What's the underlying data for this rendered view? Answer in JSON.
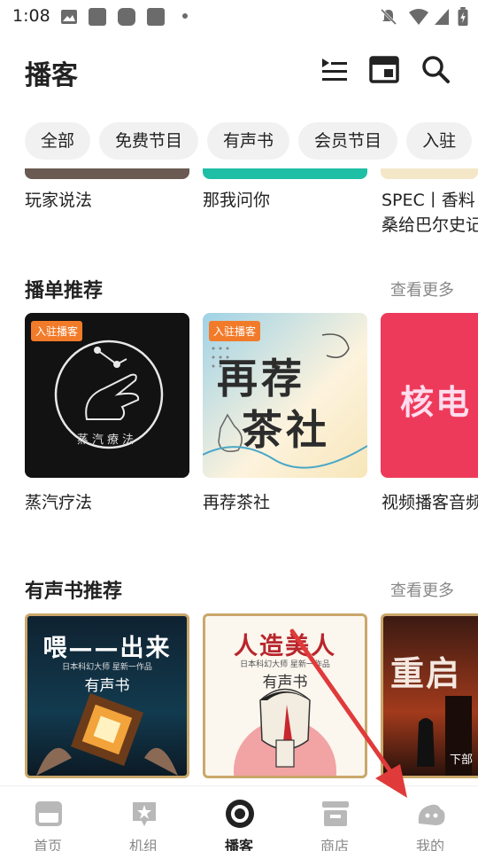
{
  "status_bar": {
    "time": "1:08"
  },
  "header": {
    "title": "播客"
  },
  "chips": [
    "全部",
    "免费节目",
    "有声书",
    "会员节目",
    "入驻"
  ],
  "top_row": [
    "玩家说法",
    "那我问你",
    "SPEC丨香料\n桑给巴尔史记"
  ],
  "playlist_section": {
    "title": "播单推荐",
    "see_more": "查看更多",
    "items": [
      {
        "title": "蒸汽疗法",
        "badge": "入驻播客",
        "cover_text": "蒸汽療法"
      },
      {
        "title": "再荐茶社",
        "badge": "入驻播客",
        "cover_text_1": "再荐",
        "cover_text_2": "茶社"
      },
      {
        "title": "视频播客音频",
        "cover_text": "核电"
      }
    ]
  },
  "audiobook_section": {
    "title": "有声书推荐",
    "see_more": "查看更多",
    "items": [
      {
        "cover_title": "喂——出来",
        "cover_sub": "日本科幻大师 星新一作品",
        "cover_tag": "有声书"
      },
      {
        "cover_title": "人造美人",
        "cover_sub": "日本科幻大师 星新一作品",
        "cover_tag": "有声书"
      },
      {
        "cover_title": "重启",
        "cover_tag": "下部"
      }
    ]
  },
  "bottom_nav": [
    {
      "label": "首页",
      "icon": "calendar-icon"
    },
    {
      "label": "机组",
      "icon": "star-icon"
    },
    {
      "label": "播客",
      "icon": "podcast-icon",
      "active": true
    },
    {
      "label": "商店",
      "icon": "shop-icon"
    },
    {
      "label": "我的",
      "icon": "profile-icon"
    }
  ],
  "colors": {
    "badge": "#f27b2a",
    "accent_arrow": "#e03a3a"
  }
}
